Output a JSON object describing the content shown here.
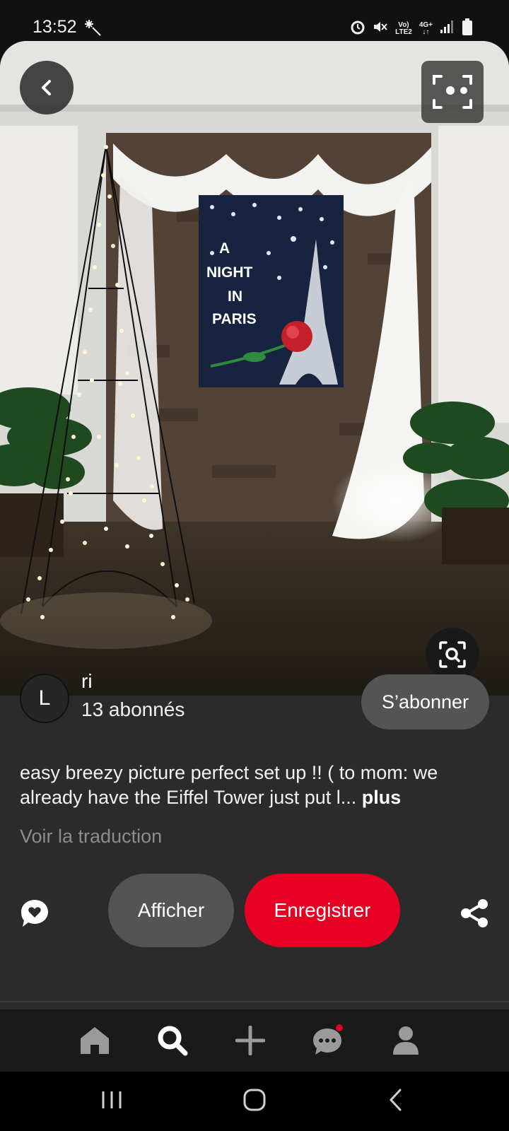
{
  "status_bar": {
    "time": "13:52",
    "network_line1": "Vo)",
    "network_line2": "LTE2",
    "network_gen": "4G+",
    "icons": [
      "sparkle-icon",
      "alarm-icon",
      "mute-icon",
      "signal-icon",
      "battery-icon"
    ]
  },
  "photo": {
    "sign_lines": [
      "A",
      "NIGHT",
      "IN",
      "PARIS"
    ]
  },
  "author": {
    "initial": "L",
    "name": "ri",
    "followers": "13 abonnés",
    "follow_label": "S’abonner"
  },
  "pin": {
    "description": "easy breezy picture perfect set up !! ( to mom: we already have the Eiffel Tower just put l...",
    "more_label": "plus",
    "translate_label": "Voir la traduction"
  },
  "actions": {
    "show_label": "Afficher",
    "save_label": "Enregistrer"
  },
  "nav": {
    "items": [
      "home-icon",
      "search-icon",
      "create-icon",
      "messages-icon",
      "profile-icon"
    ],
    "messages_badge": true
  },
  "colors": {
    "accent": "#e60023",
    "card_bg": "#2b2b2b",
    "pill_bg": "#545454"
  }
}
